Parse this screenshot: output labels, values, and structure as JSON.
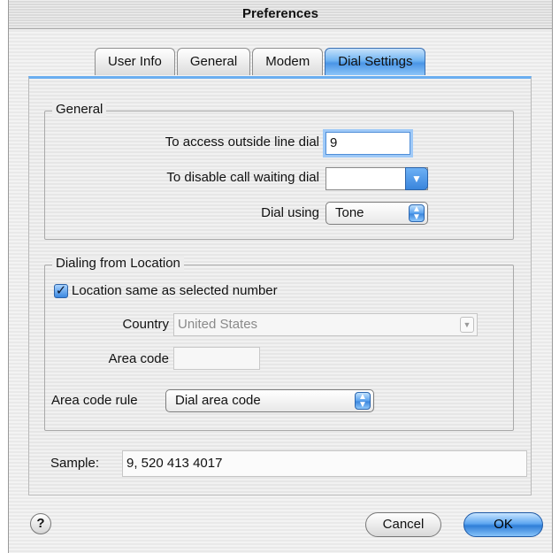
{
  "window": {
    "title": "Preferences"
  },
  "tabs": [
    {
      "label": "User Info",
      "selected": false
    },
    {
      "label": "General",
      "selected": false
    },
    {
      "label": "Modem",
      "selected": false
    },
    {
      "label": "Dial Settings",
      "selected": true
    }
  ],
  "general": {
    "legend": "General",
    "outside_line_label": "To access outside line dial",
    "outside_line_value": "9",
    "call_waiting_label": "To disable call waiting dial",
    "call_waiting_value": "",
    "dial_using_label": "Dial using",
    "dial_using_value": "Tone"
  },
  "location": {
    "legend": "Dialing from Location",
    "same_as_selected_label": "Location same as selected number",
    "same_as_selected_checked": true,
    "country_label": "Country",
    "country_value": "United States",
    "area_code_label": "Area code",
    "area_code_value": "",
    "rule_label": "Area code rule",
    "rule_value": "Dial area code"
  },
  "sample": {
    "label": "Sample:",
    "value": "9, 520 413 4017"
  },
  "buttons": {
    "help_label": "?",
    "cancel_label": "Cancel",
    "ok_label": "OK"
  },
  "colors": {
    "accent": "#4a95e6",
    "tab_border": "#3a6fb2"
  }
}
